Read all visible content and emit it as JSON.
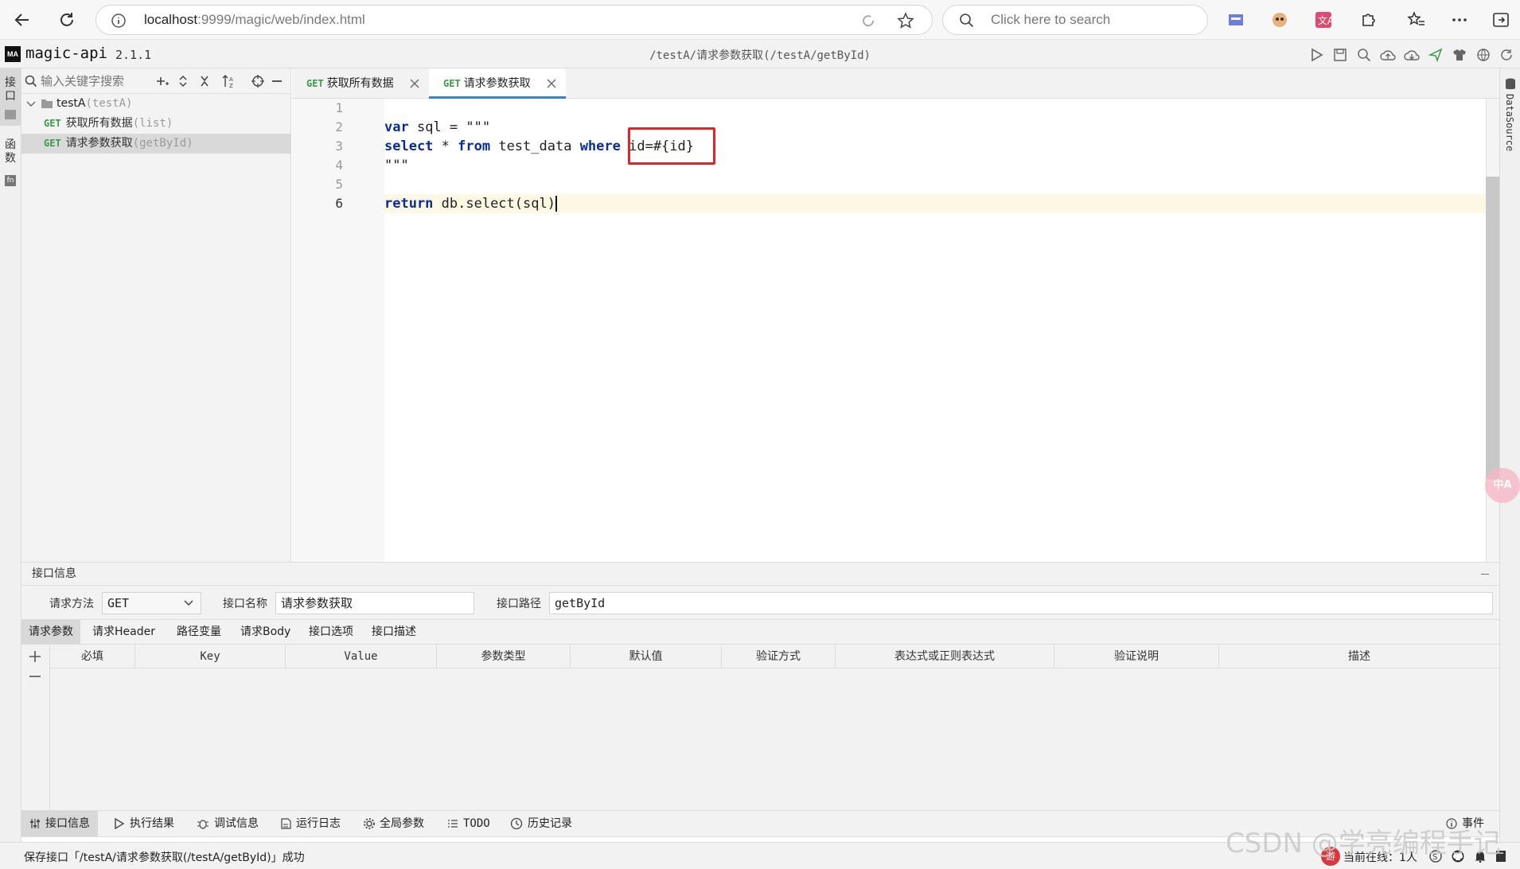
{
  "browser": {
    "url_host": "localhost",
    "url_rest": ":9999/magic/web/index.html",
    "search_placeholder": "Click here to search"
  },
  "app": {
    "logo": "MA",
    "name": "magic-api",
    "version": "2.1.1",
    "title": "/testA/请求参数获取(/testA/getById)"
  },
  "left_strip": {
    "tab_api": "接\n口",
    "tab_func": "函\n数"
  },
  "tree": {
    "search_placeholder": "输入关键字搜索",
    "group": {
      "name": "testA",
      "path": "(testA)"
    },
    "items": [
      {
        "method": "GET",
        "name": "获取所有数据",
        "path": "(list)"
      },
      {
        "method": "GET",
        "name": "请求参数获取",
        "path": "(getById)"
      }
    ]
  },
  "editor": {
    "tabs": [
      {
        "method": "GET",
        "name": "获取所有数据"
      },
      {
        "method": "GET",
        "name": "请求参数获取"
      }
    ],
    "line_numbers": [
      "1",
      "2",
      "3",
      "4",
      "5",
      "6"
    ],
    "code": {
      "l2_kw": "var",
      "l2_rest": " sql = \"\"\"",
      "l3_kw1": "select",
      "l3_mid1": " * ",
      "l3_kw2": "from",
      "l3_mid2": " test_data ",
      "l3_kw3": "where",
      "l3_rest": " id=#{id}",
      "l4": "\"\"\"",
      "l6_kw": "return",
      "l6_rest": " db.select(sql)"
    }
  },
  "right_strip": {
    "datasource": "DataSource",
    "translate_badge": "中A"
  },
  "info": {
    "header": "接口信息",
    "method_label": "请求方法",
    "method_value": "GET",
    "name_label": "接口名称",
    "name_value": "请求参数获取",
    "path_label": "接口路径",
    "path_value": "getById"
  },
  "sub_tabs": [
    "请求参数",
    "请求Header",
    "路径变量",
    "请求Body",
    "接口选项",
    "接口描述"
  ],
  "param_columns": [
    "必填",
    "Key",
    "Value",
    "参数类型",
    "默认值",
    "验证方式",
    "表达式或正则表达式",
    "验证说明",
    "描述"
  ],
  "bottom_tabs": [
    "接口信息",
    "执行结果",
    "调试信息",
    "运行日志",
    "全局参数",
    "TODO",
    "历史记录"
  ],
  "events_label": "事件",
  "status": {
    "message": "保存接口「/testA/请求参数获取(/testA/getById)」成功",
    "online": "当前在线：1人"
  },
  "watermark": "CSDN @学亮编程手记",
  "colors": {
    "get_tag": "#3c9a49",
    "keyword": "#0a2b9a",
    "highlight": "#e0242b",
    "active_tab": "#3b7fd4"
  }
}
